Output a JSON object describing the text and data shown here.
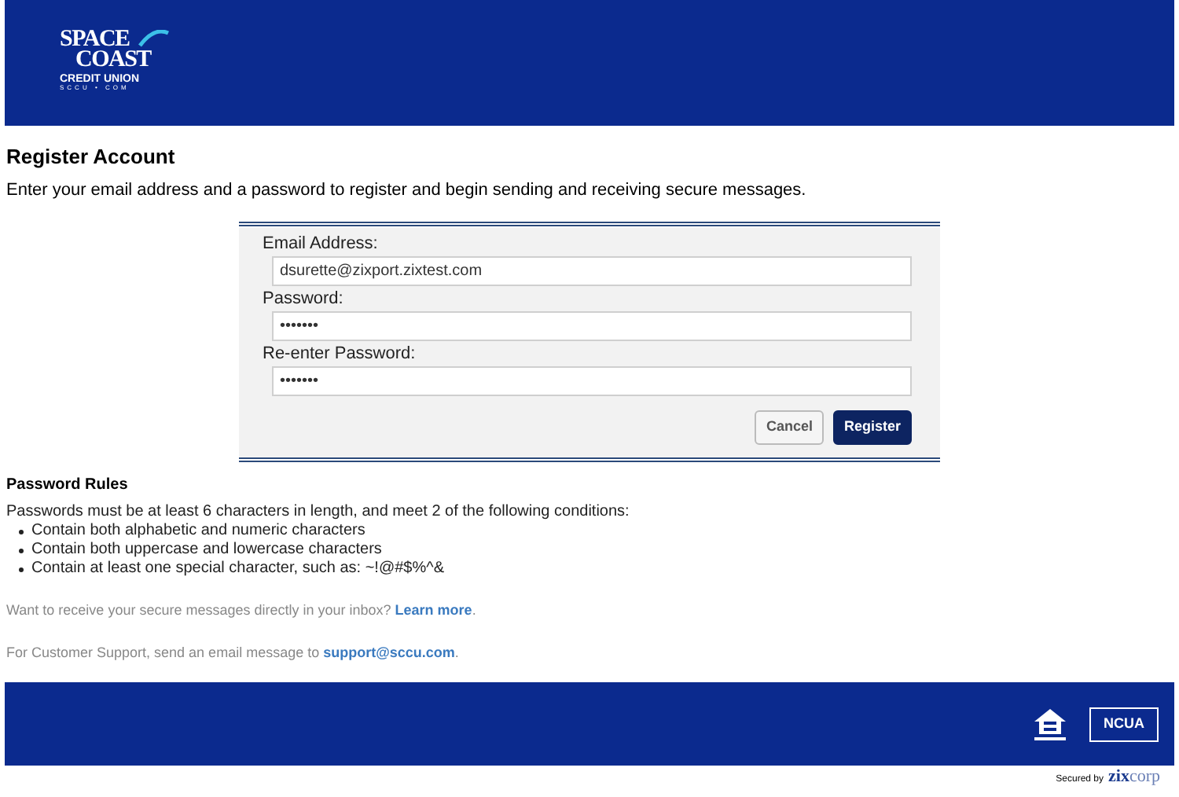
{
  "header": {
    "logo": {
      "line_1": "SPACE",
      "line_2": "COAST",
      "line_3": "CREDIT UNION",
      "line_4": "SCCU • COM"
    }
  },
  "title": "Register Account",
  "intro": "Enter your email address and a password to register and begin sending and receiving secure messages.",
  "form": {
    "fields": [
      {
        "label": "Email Address:",
        "value": "dsurette@zixport.zixtest.com"
      },
      {
        "label": "Password:",
        "value": "•••••••"
      },
      {
        "label": "Re-enter Password:",
        "value": "•••••••"
      }
    ],
    "buttons": [
      {
        "label": "Cancel",
        "kind": "secondary"
      },
      {
        "label": "Register",
        "kind": "primary"
      }
    ]
  },
  "rules": {
    "title": "Password Rules",
    "intro": "Passwords must be at least 6 characters in length, and meet 2 of the following conditions:",
    "items": [
      "Contain both alphabetic and numeric characters",
      "Contain both uppercase and lowercase characters",
      "Contain at least one special character, such as: ~!@#$%^&"
    ]
  },
  "inbox_note": {
    "text": "Want to receive your secure messages directly in your inbox?",
    "link": "Learn more",
    "end": "."
  },
  "support_note": {
    "text": "For Customer Support, send an email message to",
    "link": "support@sccu.com",
    "end": "."
  },
  "footer": {
    "ncua": "NCUA"
  },
  "secured_by": {
    "text": "Secured by",
    "brand_1": "zix",
    "brand_2": "corp"
  }
}
